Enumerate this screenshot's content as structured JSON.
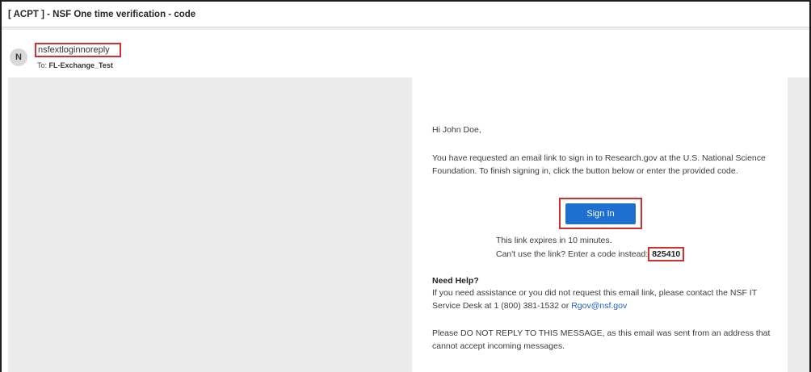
{
  "subject": "[ ACPT ] - NSF One time verification - code",
  "sender": {
    "avatar_initial": "N",
    "name": "nsfextloginnoreply",
    "to_label": "To:",
    "to_value": "FL-Exchange_Test"
  },
  "email": {
    "greeting": "Hi John Doe,",
    "intro": "You have requested an email link to sign in to Research.gov at the U.S. National Science Foundation. To finish signing in, click the button below or enter the provided code.",
    "sign_in_label": "Sign In",
    "expires": "This link expires in 10 minutes.",
    "code_prefix": "Can't use the link? Enter a code instead:",
    "code": "825410",
    "help_title": "Need Help?",
    "help_text_prefix": "If you need assistance or you did not request this email link, please contact the NSF IT Service Desk at 1 (800) 381-1532 or ",
    "help_email": "Rgov@nsf.gov",
    "do_not_reply": "Please DO NOT REPLY TO THIS MESSAGE, as this email was sent from an address that cannot accept incoming messages."
  },
  "colors": {
    "button": "#1f6fd1",
    "highlight_border": "#d32f2f",
    "link": "#1f5fc2",
    "background": "#ebebec"
  }
}
